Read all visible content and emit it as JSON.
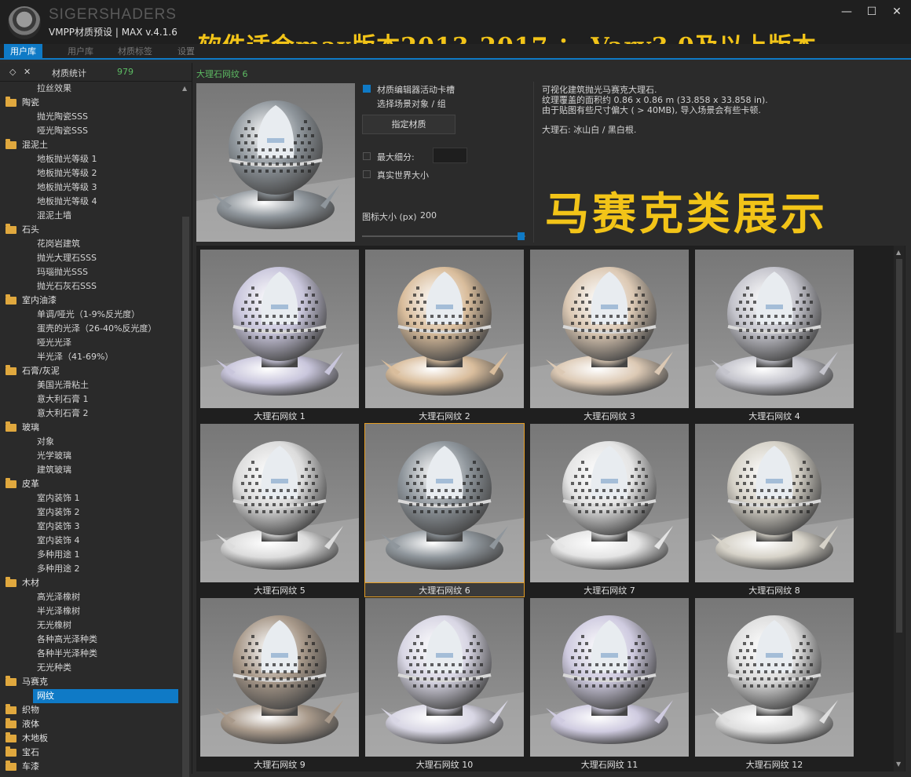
{
  "titlebar": {
    "brand": "SIGERSHADERS",
    "subtitle": "VMPP材质预设 | MAX v.4.1.6",
    "banner": "软件适合max版本2013-2017 ； Vary3.0及以上版本",
    "min": "—",
    "max": "☐",
    "close": "✕"
  },
  "tabs": [
    {
      "label": "用户库",
      "active": true
    },
    {
      "label": "用户库"
    },
    {
      "label": "材质标签"
    },
    {
      "label": "设置"
    }
  ],
  "sidebar": {
    "header": {
      "expand_icon": "◇",
      "close_icon": "✕",
      "label": "材质统计",
      "count": "979"
    },
    "tree": [
      {
        "type": "item",
        "label": "拉丝效果"
      },
      {
        "type": "cat",
        "label": "陶瓷"
      },
      {
        "type": "item",
        "label": "抛光陶瓷SSS"
      },
      {
        "type": "item",
        "label": "哑光陶瓷SSS"
      },
      {
        "type": "cat",
        "label": "混泥土"
      },
      {
        "type": "item",
        "label": "地板抛光等级 1"
      },
      {
        "type": "item",
        "label": "地板抛光等级 2"
      },
      {
        "type": "item",
        "label": "地板抛光等级 3"
      },
      {
        "type": "item",
        "label": "地板抛光等级 4"
      },
      {
        "type": "item",
        "label": "混泥土墙"
      },
      {
        "type": "cat",
        "label": "石头"
      },
      {
        "type": "item",
        "label": "花岗岩建筑"
      },
      {
        "type": "item",
        "label": "抛光大理石SSS"
      },
      {
        "type": "item",
        "label": "玛瑙抛光SSS"
      },
      {
        "type": "item",
        "label": "抛光石灰石SSS"
      },
      {
        "type": "cat",
        "label": "室内油漆"
      },
      {
        "type": "item",
        "label": "单调/哑光（1-9%反光度）"
      },
      {
        "type": "item",
        "label": "蛋壳的光泽（26-40%反光度）"
      },
      {
        "type": "item",
        "label": "哑光光泽"
      },
      {
        "type": "item",
        "label": "半光泽（41-69%）"
      },
      {
        "type": "cat",
        "label": "石膏/灰泥"
      },
      {
        "type": "item",
        "label": "美国光滑粘土"
      },
      {
        "type": "item",
        "label": "意大利石膏 1"
      },
      {
        "type": "item",
        "label": "意大利石膏 2"
      },
      {
        "type": "cat",
        "label": "玻璃"
      },
      {
        "type": "item",
        "label": "对象"
      },
      {
        "type": "item",
        "label": "光学玻璃"
      },
      {
        "type": "item",
        "label": "建筑玻璃"
      },
      {
        "type": "cat",
        "label": "皮革"
      },
      {
        "type": "item",
        "label": "室内装饰 1"
      },
      {
        "type": "item",
        "label": "室内装饰 2"
      },
      {
        "type": "item",
        "label": "室内装饰 3"
      },
      {
        "type": "item",
        "label": "室内装饰 4"
      },
      {
        "type": "item",
        "label": "多种用途 1"
      },
      {
        "type": "item",
        "label": "多种用途 2"
      },
      {
        "type": "cat",
        "label": "木材"
      },
      {
        "type": "item",
        "label": "高光泽橡树"
      },
      {
        "type": "item",
        "label": "半光泽橡树"
      },
      {
        "type": "item",
        "label": "无光橡树"
      },
      {
        "type": "item",
        "label": "各种高光泽种类"
      },
      {
        "type": "item",
        "label": "各种半光泽种类"
      },
      {
        "type": "item",
        "label": "无光种类"
      },
      {
        "type": "cat",
        "label": "马赛克"
      },
      {
        "type": "item",
        "label": "网纹",
        "selected": true
      },
      {
        "type": "cat",
        "label": "织物"
      },
      {
        "type": "cat",
        "label": "液体"
      },
      {
        "type": "cat",
        "label": "木地板"
      },
      {
        "type": "cat",
        "label": "宝石"
      },
      {
        "type": "cat",
        "label": "车漆"
      }
    ],
    "scroll_up": "▲",
    "scroll_down": "▼"
  },
  "detail": {
    "breadcrumb": "大理石网纹 6",
    "opt_slot": "材质编辑器活动卡槽",
    "opt_select": "选择场景对象 / 组",
    "assign_button": "指定材质",
    "opt_maxsub": "最大细分:",
    "opt_realworld": "真实世界大小",
    "icon_size_label": "图标大小 (px)",
    "icon_size_value": "200",
    "desc_line1": "可视化建筑抛光马赛克大理石.",
    "desc_line2": "纹理覆盖的面积约 0.86 x 0.86 m (33.858 x 33.858 in).",
    "desc_line3": "由于贴图有些尺寸偏大 ( > 40MB), 导入场景会有些卡顿.",
    "desc_line4": "大理石: 冰山白 / 黑白根.",
    "promo": "马赛克类展示"
  },
  "grid": {
    "scroll_up": "▲",
    "scroll_down": "▼",
    "items": [
      {
        "label": "大理石网纹 1",
        "tint": "#c9c6dc"
      },
      {
        "label": "大理石网纹 2",
        "tint": "#d9bd9c"
      },
      {
        "label": "大理石网纹 3",
        "tint": "#dcc9b4"
      },
      {
        "label": "大理石网纹 4",
        "tint": "#c4c4cc"
      },
      {
        "label": "大理石网纹 5",
        "tint": "#dcdcdc"
      },
      {
        "label": "大理石网纹 6",
        "tint": "#8f969c",
        "selected": true
      },
      {
        "label": "大理石网纹 7",
        "tint": "#e4e4e4"
      },
      {
        "label": "大理石网纹 8",
        "tint": "#d6d2c8"
      },
      {
        "label": "大理石网纹 9",
        "tint": "#a8998a"
      },
      {
        "label": "大理石网纹 10",
        "tint": "#d8d6e4"
      },
      {
        "label": "大理石网纹 11",
        "tint": "#cfcbe0"
      },
      {
        "label": "大理石网纹 12",
        "tint": "#dedede"
      }
    ]
  },
  "colors": {
    "accent": "#0f7ac6",
    "banner": "#f2c418",
    "breadcrumb": "#5dbb63",
    "folder": "#e0a83e",
    "selection_border": "#e59d23"
  }
}
